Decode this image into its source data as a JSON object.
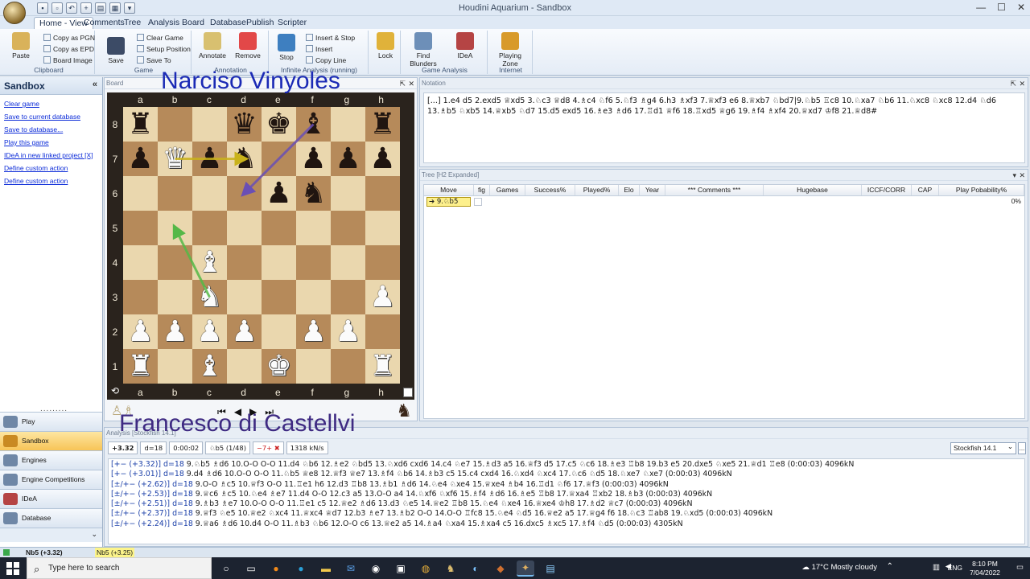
{
  "window": {
    "title": "Houdini Aquarium - Sandbox",
    "controls": [
      "—",
      "☐",
      "✕"
    ]
  },
  "ribbon_tabs": [
    "Home - View",
    "Comments",
    "Tree",
    "Analysis",
    "Board",
    "Database",
    "Publish",
    "Scripter"
  ],
  "ribbon": {
    "clipboard": {
      "label": "Clipboard",
      "paste": "Paste",
      "copy_pgn": "Copy as PGN",
      "copy_epd": "Copy as EPD",
      "board_image": "Board Image"
    },
    "game": {
      "label": "Game",
      "save": "Save",
      "clear_game": "Clear Game",
      "setup_position": "Setup Position",
      "save_to": "Save To"
    },
    "annotation": {
      "label": "Annotation",
      "annotate": "Annotate",
      "remove": "Remove"
    },
    "infinite": {
      "label": "Infinite Analysis (running)",
      "stop": "Stop",
      "insert_stop": "Insert & Stop",
      "insert": "Insert",
      "copy_line": "Copy Line"
    },
    "lock": {
      "label": "Lock"
    },
    "game_analysis": {
      "label": "Game Analysis",
      "find_blunders": "Find Blunders",
      "idea": "IDeA"
    },
    "internet": {
      "label": "Internet",
      "playing_zone": "Playing Zone"
    }
  },
  "sidebar": {
    "title": "Sandbox",
    "collapse": "«",
    "links": [
      "Clear game",
      "Save to current database",
      "Save to database...",
      "Play this game",
      "IDeA in new linked project   [X]",
      "Define custom action",
      "Define custom action"
    ],
    "grip": ".........",
    "nav": [
      "Play",
      "Sandbox",
      "Engines",
      "Engine Competitions",
      "IDeA",
      "Database"
    ],
    "nav_active": "Sandbox",
    "footer_arrow": "⌄"
  },
  "board_panel": {
    "caption": "Board",
    "files": [
      "a",
      "b",
      "c",
      "d",
      "e",
      "f",
      "g",
      "h"
    ],
    "ranks": [
      "8",
      "7",
      "6",
      "5",
      "4",
      "3",
      "2",
      "1"
    ],
    "position": [
      [
        "br",
        "",
        "",
        "bq",
        "bk",
        "bb",
        "",
        "br"
      ],
      [
        "bp",
        "wq",
        "bp",
        "bn",
        "",
        "bp",
        "bp",
        "bp"
      ],
      [
        "",
        "",
        "",
        "",
        "bp",
        "bn",
        "",
        ""
      ],
      [
        "",
        "",
        "",
        "",
        "",
        "",
        "",
        ""
      ],
      [
        "",
        "",
        "wb",
        "",
        "",
        "",
        "",
        ""
      ],
      [
        "",
        "",
        "wn",
        "",
        "",
        "",
        "",
        "wp"
      ],
      [
        "wp",
        "wp",
        "wp",
        "wp",
        "",
        "wp",
        "wp",
        ""
      ],
      [
        "wr",
        "",
        "wb",
        "",
        "wk",
        "",
        "",
        "wr"
      ]
    ],
    "arrows": [
      {
        "from": "b7",
        "to": "d7",
        "color": "#c9b21a"
      },
      {
        "from": "f8",
        "to": "d6",
        "color": "#6a4fb5"
      },
      {
        "from": "c3",
        "to": "b5",
        "color": "#55b847"
      }
    ],
    "nav_controls": [
      "⏮",
      "◀",
      "▶",
      "⏭"
    ],
    "flip_icon": "⟲"
  },
  "players": {
    "white": "Narciso Vinyoles",
    "black": "Francesco di Castellvi"
  },
  "notation": {
    "caption": "Notation",
    "text": "[...] 1.e4 d5 2.exd5 ♕xd5 3.♘c3 ♕d8 4.♗c4 ♘f6 5.♘f3 ♗g4 6.h3 ♗xf3 7.♕xf3 e6 8.♕xb7 ♘bd7|9.♘b5 ♖c8 10.♘xa7 ♘b6 11.♘xc8 ♘xc8 12.d4 ♘d6 13.♗b5 ♘xb5 14.♕xb5 ♘d7 15.d5 exd5 16.♗e3 ♗d6 17.♖d1 ♕f6 18.♖xd5 ♕g6 19.♗f4 ♗xf4 20.♕xd7 ♔f8 21.♕d8#"
  },
  "tree": {
    "caption": "Tree [H2 Expanded]",
    "columns": [
      "Move",
      "fig",
      "Games",
      "Success%",
      "Played%",
      "Elo",
      "Year",
      "*** Comments ***",
      "Hugebase",
      "ICCF/CORR",
      "CAP",
      "Play Pobability%"
    ],
    "row": {
      "move": "9.♘b5",
      "probability": "0%"
    }
  },
  "analysis": {
    "caption": "Analysis [Stockfish 14.1]",
    "toolbar": [
      "+3.32",
      "d=18",
      "0:00:02",
      "♘b5 (1/48)",
      "−7+ ✖",
      "1318 kN/s"
    ],
    "engine": "Stockfish 14.1",
    "more": "...",
    "lines": [
      {
        "eval": "[+−  (+3.32)]",
        "depth": "d=18",
        "moves": "9.♘b5 ♗d6 10.O-O O-O 11.d4 ♘b6 12.♗e2 ♘bd5 13.♘xd6 cxd6 14.c4 ♘e7 15.♗d3 a5 16.♕f3 d5 17.c5 ♘c6 18.♗e3 ♖b8 19.b3 e5 20.dxe5 ♘xe5 21.♕d1 ♖e8 (0:00:03) 4096kN"
      },
      {
        "eval": "[+−  (+3.01)]",
        "depth": "d=18",
        "moves": "9.d4 ♗d6 10.O-O O-O 11.♘b5 ♕e8 12.♕f3 ♕e7 13.♗f4 ♘b6 14.♗b3 c5 15.c4 cxd4 16.♘xd4 ♘xc4 17.♘c6 ♘d5 18.♘xe7 ♘xe7 (0:00:03) 4096kN"
      },
      {
        "eval": "[±/+− (+2.62)]",
        "depth": "d=18",
        "moves": "9.O-O ♗c5 10.♕f3 O-O 11.♖e1 h6 12.d3 ♖b8 13.♗b1 ♗d6 14.♘e4 ♘xe4 15.♕xe4 ♗b4 16.♖d1 ♘f6 17.♕f3 (0:00:03) 4096kN"
      },
      {
        "eval": "[±/+− (+2.53)]",
        "depth": "d=18",
        "moves": "9.♕c6 ♗c5 10.♘e4 ♗e7 11.d4 O-O 12.c3 a5 13.O-O a4 14.♘xf6 ♘xf6 15.♗f4 ♗d6 16.♗e5 ♖b8 17.♕xa4 ♖xb2 18.♗b3 (0:00:03) 4096kN"
      },
      {
        "eval": "[±/+− (+2.51)]",
        "depth": "d=18",
        "moves": "9.♗b3 ♗e7 10.O-O O-O 11.♖e1 c5 12.♕e2 ♗d6 13.d3 ♘e5 14.♕e2 ♖b8 15.♘e4 ♘xe4 16.♕xe4 ♔h8 17.♗d2 ♕c7 (0:00:03) 4096kN"
      },
      {
        "eval": "[±/+− (+2.37)]",
        "depth": "d=18",
        "moves": "9.♕f3 ♘e5 10.♕e2 ♘xc4 11.♕xc4 ♕d7 12.b3 ♗e7 13.♗b2 O-O 14.O-O ♖fc8 15.♘e4 ♘d5 16.♕e2 a5 17.♕g4 f6 18.♘c3 ♖ab8 19.♘xd5 (0:00:03) 4096kN"
      },
      {
        "eval": "[±/+− (+2.24)]",
        "depth": "d=18",
        "moves": "9.♕a6 ♗d6 10.d4 O-O 11.♗b3 ♘b6 12.O-O c6 13.♕e2 a5 14.♗a4 ♘xa4 15.♗xa4 c5 16.dxc5 ♗xc5 17.♗f4 ♘d5 (0:00:03) 4305kN"
      }
    ]
  },
  "statusbar": {
    "main": "Nb5 (+3.32)",
    "alt": "Nb5 (+3.25)"
  },
  "taskbar": {
    "search_placeholder": "Type here to search",
    "weather": "17°C  Mostly cloudy",
    "tray_arrow": "⌃",
    "lang": "ENG",
    "time": "8:10 PM",
    "date": "7/04/2022"
  },
  "colors": {
    "accent": "#f7c457",
    "link": "#0b2bd8",
    "board_light": "#ead7ae",
    "board_dark": "#b68a5a"
  }
}
